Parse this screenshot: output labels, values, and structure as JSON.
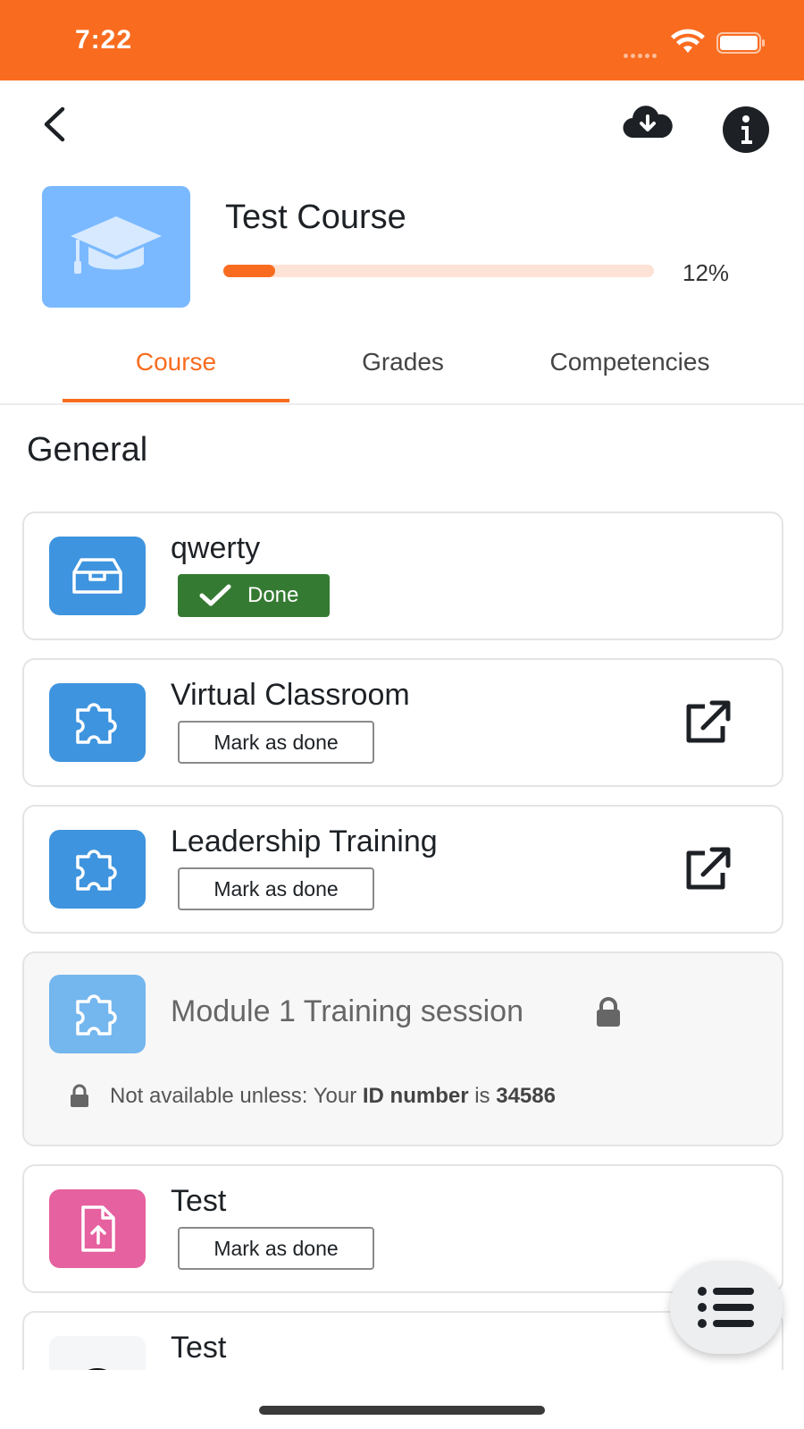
{
  "status_bar": {
    "time": "7:22"
  },
  "course": {
    "title": "Test Course",
    "progress_percent": 12,
    "progress_text": "12%"
  },
  "tabs": [
    {
      "label": "Course",
      "active": true
    },
    {
      "label": "Grades",
      "active": false
    },
    {
      "label": "Competencies",
      "active": false
    }
  ],
  "section": {
    "title": "General"
  },
  "modules": [
    {
      "title": "qwerty",
      "icon": "box-icon",
      "color": "#3e94de",
      "status": "Done"
    },
    {
      "title": "Virtual Classroom",
      "icon": "puzzle-icon",
      "color": "#3e94de",
      "action": "Mark as done",
      "external": true
    },
    {
      "title": "Leadership Training",
      "icon": "puzzle-icon",
      "color": "#3e94de",
      "action": "Mark as done",
      "external": true
    },
    {
      "title": "Module 1 Training session",
      "icon": "puzzle-icon",
      "color": "#74b6ee",
      "locked": true,
      "restriction": {
        "prefix": "Not available unless: Your ",
        "field": "ID number",
        "middle": " is ",
        "value": "34586"
      }
    },
    {
      "title": "Test",
      "icon": "assignment-icon",
      "color": "#e6619f",
      "action": "Mark as done"
    },
    {
      "title": "Test",
      "icon": "avatar-icon"
    }
  ],
  "colors": {
    "accent": "#f96c1f",
    "done": "#357a32"
  }
}
